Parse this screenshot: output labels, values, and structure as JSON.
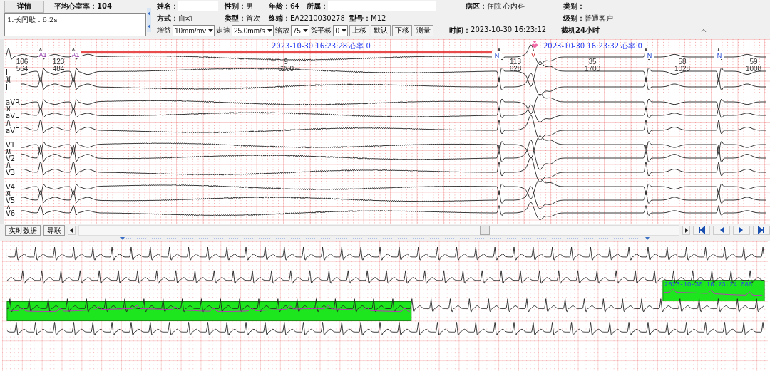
{
  "summary": {
    "tab": "详情",
    "avg_rate": "平均心室率：104",
    "findings": [
      "1.长间歇：6.2s"
    ]
  },
  "info_rows": [
    [
      {
        "label": "姓名：",
        "kind": "input"
      },
      {
        "label": "性别：",
        "kind": "text",
        "value": "男"
      },
      {
        "label": "年龄：",
        "kind": "text",
        "value": "64"
      },
      {
        "label": "所属：",
        "kind": "input"
      },
      {
        "label": "病区：",
        "kind": "text",
        "value": "住院 心内科"
      },
      {
        "label": "类别：",
        "kind": "text"
      }
    ],
    [
      {
        "label": "方式：",
        "kind": "text",
        "value": "自动"
      },
      {
        "label": "类型：",
        "kind": "text",
        "value": "首次"
      },
      {
        "label": "终端：",
        "kind": "text",
        "value": "EA2210030278"
      },
      {
        "label": "型号：",
        "kind": "text",
        "value": "M12"
      },
      {
        "label": "级别：",
        "kind": "text",
        "value": "普通客户"
      }
    ]
  ],
  "controls": [
    {
      "kind": "label",
      "text": "增益"
    },
    {
      "kind": "select",
      "value": "10mm/mv"
    },
    {
      "kind": "label",
      "text": "走速"
    },
    {
      "kind": "select",
      "value": "25.0mm/s"
    },
    {
      "kind": "label",
      "text": "缩放"
    },
    {
      "kind": "select",
      "value": "75"
    },
    {
      "kind": "label",
      "text": "%平移"
    },
    {
      "kind": "select",
      "value": "0"
    },
    {
      "kind": "button",
      "text": "上移"
    },
    {
      "kind": "button",
      "text": "默认"
    },
    {
      "kind": "button",
      "text": "下移"
    },
    {
      "kind": "button",
      "text": "测量"
    }
  ],
  "time": {
    "label": "时间：",
    "value": "2023-10-30 16:23:12"
  },
  "mode": "截机24小时",
  "ecg": {
    "leads": [
      "I",
      "III",
      "aVR",
      "aVL",
      "aVF",
      "V1",
      "V2",
      "V3",
      "V4",
      "V5",
      "V6"
    ],
    "beats": [
      "A1",
      "A1",
      "N",
      "V",
      "N",
      "N"
    ],
    "intervals": [
      {
        "rate": "106",
        "ms": "564"
      },
      {
        "rate": "123",
        "ms": "484"
      },
      {
        "rate": "9",
        "ms": "6200"
      },
      {
        "rate": "113",
        "ms": "628"
      },
      {
        "rate": "35",
        "ms": "1700"
      },
      {
        "rate": "58",
        "ms": "1028"
      },
      {
        "rate": "59",
        "ms": "1008"
      }
    ],
    "time_marks": [
      {
        "time": "2023-10-30 16:23:28",
        "rate": "心率 0"
      },
      {
        "time": "2023-10-30 16:23:32",
        "rate": "心率 0"
      }
    ]
  },
  "bottom_bar": {
    "buttons": [
      "实时数据",
      "导联"
    ]
  },
  "strip": {
    "stamp": "2023-10-30 16:23:24:086"
  }
}
